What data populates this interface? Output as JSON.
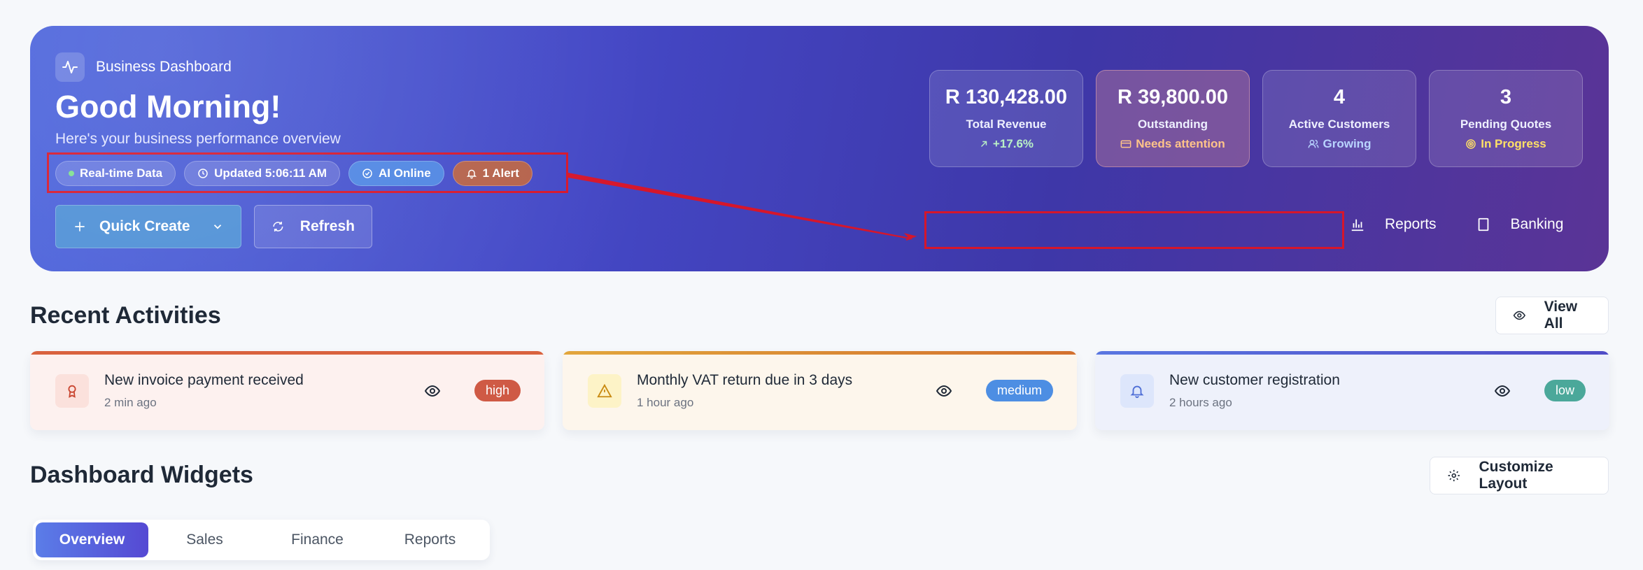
{
  "hero": {
    "brand": "Business Dashboard",
    "greeting": "Good Morning!",
    "subtitle": "Here's your business performance overview",
    "chips": {
      "realtime": "Real-time Data",
      "updated": "Updated 5:06:11 AM",
      "ai": "AI Online",
      "alert": "1 Alert"
    },
    "quick_create": "Quick Create",
    "refresh": "Refresh",
    "stats": [
      {
        "value": "R 130,428.00",
        "label": "Total Revenue",
        "sub": "+17.6%"
      },
      {
        "value": "R 39,800.00",
        "label": "Outstanding",
        "sub": "Needs attention"
      },
      {
        "value": "4",
        "label": "Active Customers",
        "sub": "Growing"
      },
      {
        "value": "3",
        "label": "Pending Quotes",
        "sub": "In Progress"
      }
    ],
    "links": {
      "reports": "Reports",
      "banking": "Banking"
    }
  },
  "activities": {
    "title": "Recent Activities",
    "view_all": "View All",
    "items": [
      {
        "title": "New invoice payment received",
        "time": "2 min ago",
        "priority": "high"
      },
      {
        "title": "Monthly VAT return due in 3 days",
        "time": "1 hour ago",
        "priority": "medium"
      },
      {
        "title": "New customer registration",
        "time": "2 hours ago",
        "priority": "low"
      }
    ]
  },
  "widgets": {
    "title": "Dashboard Widgets",
    "customize": "Customize Layout",
    "tabs": [
      "Overview",
      "Sales",
      "Finance",
      "Reports"
    ]
  },
  "colors": {
    "annotation": "#d6162b",
    "high": "#cf5a45",
    "medium": "#4d8ee3",
    "low": "#4ba89a"
  }
}
